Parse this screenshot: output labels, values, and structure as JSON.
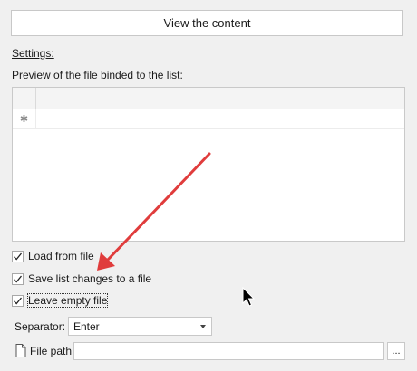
{
  "view_button": {
    "label": "View the content"
  },
  "settings": {
    "label": "Settings:"
  },
  "preview": {
    "label": "Preview of the file binded to the list:"
  },
  "grid": {
    "new_row_marker": "✱"
  },
  "options": {
    "load_from_file": {
      "label": "Load from file",
      "checked": true
    },
    "save_list_changes": {
      "label": "Save list changes to a file",
      "checked": true
    },
    "leave_empty_file": {
      "label": "Leave empty file",
      "checked": true
    }
  },
  "separator": {
    "label": "Separator:",
    "value": "Enter"
  },
  "file_path": {
    "label": "File path",
    "value": "",
    "browse_label": "..."
  },
  "annotation": {
    "arrow_color": "#e03c3c"
  },
  "icons": {
    "caret": "chevron-down-icon",
    "file": "file-icon",
    "cursor": "mouse-cursor-icon",
    "check": "checkmark-icon"
  }
}
